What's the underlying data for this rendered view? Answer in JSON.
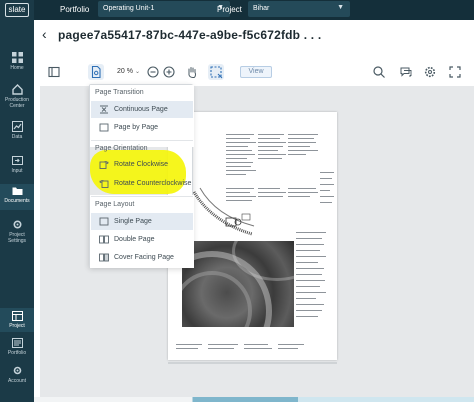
{
  "brand": {
    "logo_text": "slate"
  },
  "sidebar": {
    "items": [
      {
        "label": "Home",
        "icon": "grid-icon"
      },
      {
        "label": "Production Center",
        "icon": "home-icon"
      },
      {
        "label": "Data",
        "icon": "chart-icon"
      },
      {
        "label": "Input",
        "icon": "input-icon"
      },
      {
        "label": "Documents",
        "icon": "folder-icon"
      },
      {
        "label": "Project Settings",
        "icon": "gear-icon"
      }
    ],
    "bottom_items": [
      {
        "label": "Project",
        "icon": "project-icon"
      },
      {
        "label": "Portfolio",
        "icon": "portfolio-icon"
      },
      {
        "label": "Account",
        "icon": "account-icon"
      }
    ]
  },
  "topbar": {
    "portfolio_label": "Portfolio",
    "portfolio_value": "Operating Unit-1",
    "project_label": "Project",
    "project_value": "Bihar"
  },
  "header": {
    "title": "pagee7a55417-87bc-447e-a9be-f5c672fdb . . ."
  },
  "toolbar": {
    "zoom_value": "20 %",
    "view_label": "View"
  },
  "menu": {
    "transition_title": "Page Transition",
    "transition_items": [
      "Continuous Page",
      "Page by Page"
    ],
    "orientation_title": "Page Orientation",
    "orientation_items": [
      "Rotate Clockwise",
      "Rotate Counterclockwise"
    ],
    "layout_title": "Page Layout",
    "layout_items": [
      "Single Page",
      "Double Page",
      "Cover Facing Page"
    ],
    "selected_transition": "Continuous Page",
    "selected_layout": "Single Page"
  },
  "colors": {
    "sidebar": "#1b3a47",
    "topbar": "#142f3a",
    "highlight": "#f5f50a",
    "accent": "#2e6fb5"
  }
}
